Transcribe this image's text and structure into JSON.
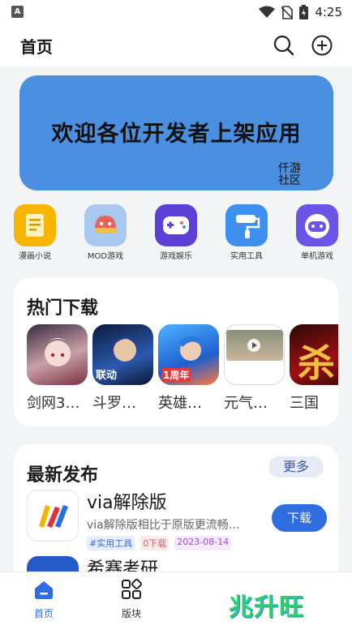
{
  "status_bar": {
    "time": "4:25"
  },
  "header": {
    "title": "首页"
  },
  "banner": {
    "text": "欢迎各位开发者上架应用",
    "signature": "仟游社区"
  },
  "categories": [
    {
      "label": "漫画小说",
      "icon": "book-icon",
      "color": "#f7b500"
    },
    {
      "label": "MOD游戏",
      "icon": "mod-game-icon",
      "color": "#e8625a"
    },
    {
      "label": "游戏娱乐",
      "icon": "gamepad-icon",
      "color": "#5b3fd6"
    },
    {
      "label": "实用工具",
      "icon": "paint-roller-icon",
      "color": "#3d8ff0"
    },
    {
      "label": "单机游戏",
      "icon": "controller-icon",
      "color": "#6a55e8"
    }
  ],
  "hot": {
    "title": "热门下载",
    "items": [
      {
        "name": "剑网3…",
        "icon": "jianwang3-app-icon"
      },
      {
        "name": "斗罗…",
        "icon": "douluo-app-icon",
        "badge": "联动"
      },
      {
        "name": "英雄…",
        "icon": "yingxiong-app-icon",
        "badge": "1周年"
      },
      {
        "name": "元气…",
        "icon": "yuanqi-app-icon"
      },
      {
        "name": "三国",
        "icon": "sanguo-app-icon",
        "glyph": "杀"
      }
    ]
  },
  "latest": {
    "title": "最新发布",
    "more_label": "更多",
    "apps": [
      {
        "name": "via解除版",
        "desc": "via解除版相比于原版更流畅…",
        "tags": [
          "#实用工具",
          "0下载",
          "2023-08-14"
        ],
        "download_label": "下载"
      },
      {
        "name": "希赛考研"
      }
    ]
  },
  "bottom_nav": {
    "items": [
      {
        "label": "首页",
        "icon": "home-icon",
        "active": true
      },
      {
        "label": "版块",
        "icon": "blocks-icon",
        "active": false
      }
    ],
    "watermark": "兆升旺"
  },
  "colors": {
    "accent": "#2e6ce0",
    "banner": "#4a8fe0",
    "tag_blue": "#3b6fd8",
    "tag_red": "#e85a6a",
    "tag_purple": "#a24fd6"
  }
}
